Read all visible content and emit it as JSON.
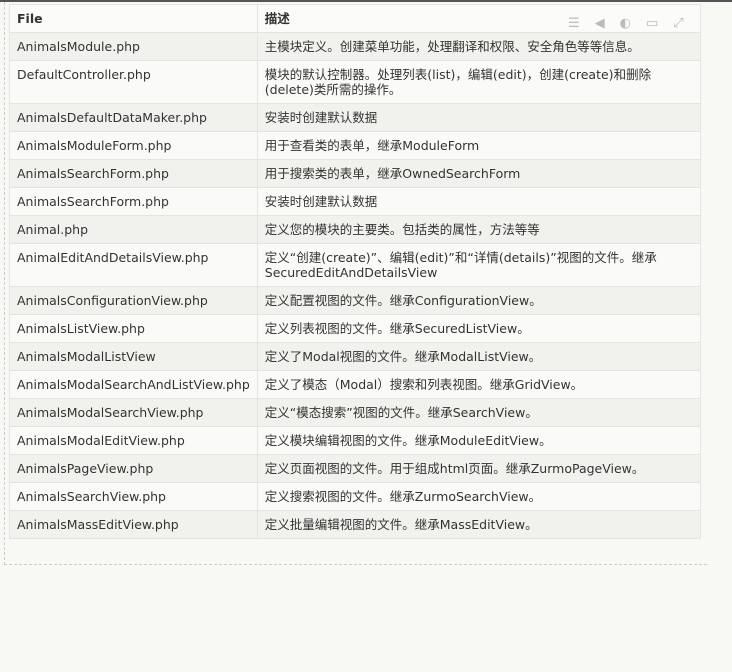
{
  "headers": {
    "file": "File",
    "desc": "描述"
  },
  "rows": [
    {
      "file": "AnimalsModule.php",
      "desc": "主模块定义。创建菜单功能，处理翻译和权限、安全角色等等信息。"
    },
    {
      "file": "DefaultController.php",
      "desc": "模块的默认控制器。处理列表(list)，编辑(edit)，创建(create)和删除(delete)类所需的操作。"
    },
    {
      "file": "AnimalsDefaultDataMaker.php",
      "desc": "安装时创建默认数据"
    },
    {
      "file": "AnimalsModuleForm.php",
      "desc": "用于查看类的表单，继承ModuleForm"
    },
    {
      "file": "AnimalsSearchForm.php",
      "desc": "用于搜索类的表单，继承OwnedSearchForm"
    },
    {
      "file": "AnimalsSearchForm.php",
      "desc": "安装时创建默认数据"
    },
    {
      "file": "Animal.php",
      "desc": "定义您的模块的主要类。包括类的属性，方法等等"
    },
    {
      "file": "AnimalEditAndDetailsView.php",
      "desc": "定义“创建(create)”、编辑(edit)”和“详情(details)”视图的文件。继承SecuredEditAndDetailsView"
    },
    {
      "file": "AnimalsConfigurationView.php",
      "desc": "定义配置视图的文件。继承ConfigurationView。"
    },
    {
      "file": "AnimalsListView.php",
      "desc": "定义列表视图的文件。继承SecuredListView。"
    },
    {
      "file": "AnimalsModalListView",
      "desc": "定义了Modal视图的文件。继承ModalListView。"
    },
    {
      "file": "AnimalsModalSearchAndListView.php",
      "desc": "定义了模态（Modal）搜索和列表视图。继承GridView。"
    },
    {
      "file": "AnimalsModalSearchView.php",
      "desc": "定义“模态搜索”视图的文件。继承SearchView。"
    },
    {
      "file": "AnimalsModalEditView.php",
      "desc": "定义模块编辑视图的文件。继承ModuleEditView。"
    },
    {
      "file": "AnimalsPageView.php",
      "desc": "定义页面视图的文件。用于组成html页面。继承ZurmoPageView。"
    },
    {
      "file": "AnimalsSearchView.php",
      "desc": "定义搜索视图的文件。继承ZurmoSearchView。"
    },
    {
      "file": "AnimalsMassEditView.php",
      "desc": "定义批量编辑视图的文件。继承MassEditView。"
    }
  ]
}
